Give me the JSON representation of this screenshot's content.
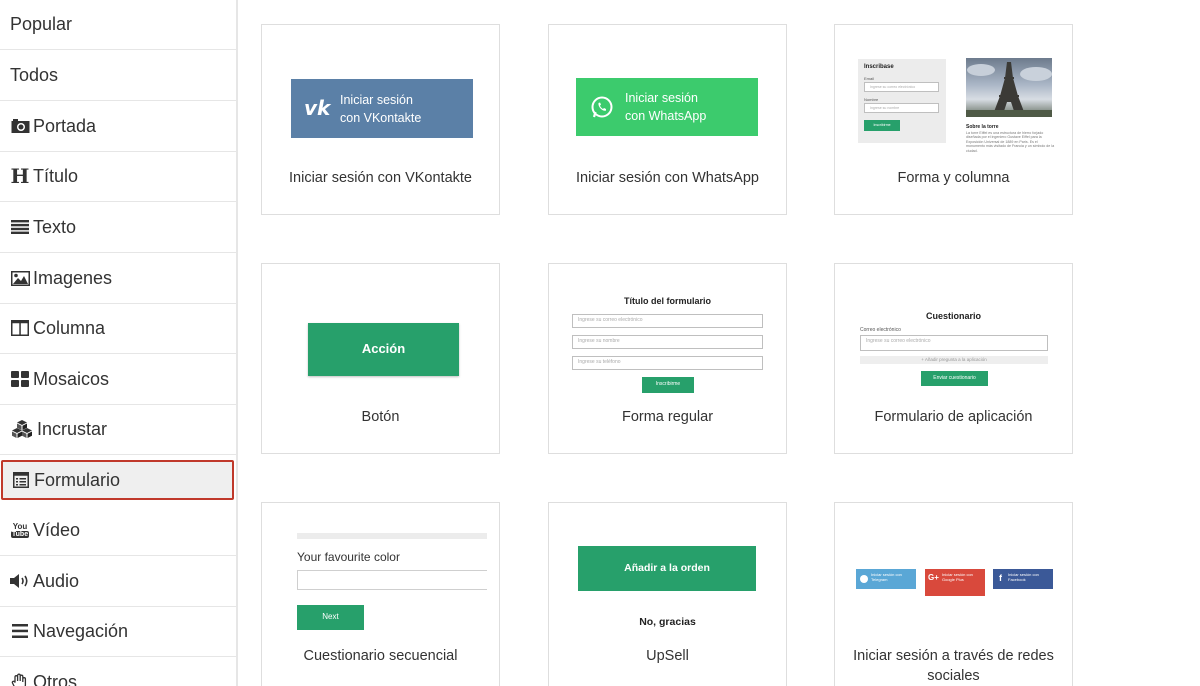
{
  "sidebar": {
    "items": [
      {
        "label": "Popular",
        "icon": ""
      },
      {
        "label": "Todos",
        "icon": ""
      },
      {
        "label": "Portada",
        "icon": "camera-icon"
      },
      {
        "label": "Título",
        "icon": "heading-icon"
      },
      {
        "label": "Texto",
        "icon": "align-justify-icon"
      },
      {
        "label": "Imagenes",
        "icon": "image-icon"
      },
      {
        "label": "Columna",
        "icon": "columns-icon"
      },
      {
        "label": "Mosaicos",
        "icon": "th-large-icon"
      },
      {
        "label": "Incrustar",
        "icon": "cubes-icon"
      },
      {
        "label": "Formulario",
        "icon": "form-icon"
      },
      {
        "label": "Vídeo",
        "icon": "youtube-icon"
      },
      {
        "label": "Audio",
        "icon": "volume-icon"
      },
      {
        "label": "Navegación",
        "icon": "bars-icon"
      },
      {
        "label": "Otros",
        "icon": "hand-icon"
      }
    ],
    "active": "Formulario",
    "youtube_badge_top": "You",
    "youtube_badge_bottom": "Tube"
  },
  "cards": {
    "vk": {
      "label": "Iniciar sesión con VKontakte",
      "btn_line1": "Iniciar sesión",
      "btn_line2": "con VKontakte",
      "color": "#5b80a7"
    },
    "whatsapp": {
      "label": "Iniciar sesión con WhatsApp",
      "btn_line1": "Iniciar sesión",
      "btn_line2": "con WhatsApp",
      "color": "#3ccb6d"
    },
    "form_column": {
      "label": "Forma y columna",
      "form_title": "Inscribase",
      "email_label": "Email",
      "email_placeholder": "Ingrese su correo electrónico",
      "name_label": "Nombre",
      "name_placeholder": "Ingrese su nombre",
      "submit": "Inscribirme",
      "column_title": "Sobre la torre",
      "column_text": "La torre Eiffel es una estructura de hierro forjado diseñada por el ingeniero Gustave Eiffel para la Exposición Universal de 1889 en París. Es el monumento más visitado de Francia y un símbolo de la ciudad."
    },
    "button": {
      "label": "Botón",
      "btn_text": "Acción"
    },
    "regular_form": {
      "label": "Forma regular",
      "title": "Título del formulario",
      "field1": "Ingrese su correo electrónico",
      "field2": "Ingrese su nombre",
      "field3": "Ingrese su teléfono",
      "submit": "Inscribirme"
    },
    "application_form": {
      "label": "Formulario de aplicación",
      "title": "Cuestionario",
      "field_label": "Correo electrónico",
      "field_placeholder": "Ingrese su correo electrónico",
      "add_question": "+ Añadir pregunta a la aplicación",
      "submit": "Enviar cuestionario"
    },
    "sequential": {
      "label": "Cuestionario secuencial",
      "question": "Your favourite color",
      "next": "Next"
    },
    "upsell": {
      "label": "UpSell",
      "add_btn": "Añadir a la orden",
      "decline": "No, gracias"
    },
    "social": {
      "label": "Iniciar sesión a través de redes sociales",
      "telegram": "Iniciar sesión con Telegram",
      "google": "Iniciar sesión con Google Plus",
      "facebook": "Iniciar sesión con Facebook",
      "telegram_color": "#5aa7d6",
      "google_color": "#d9493c",
      "facebook_color": "#3b5998"
    }
  },
  "colors": {
    "accent_green": "#27a06b",
    "active_border": "#c0392b"
  }
}
